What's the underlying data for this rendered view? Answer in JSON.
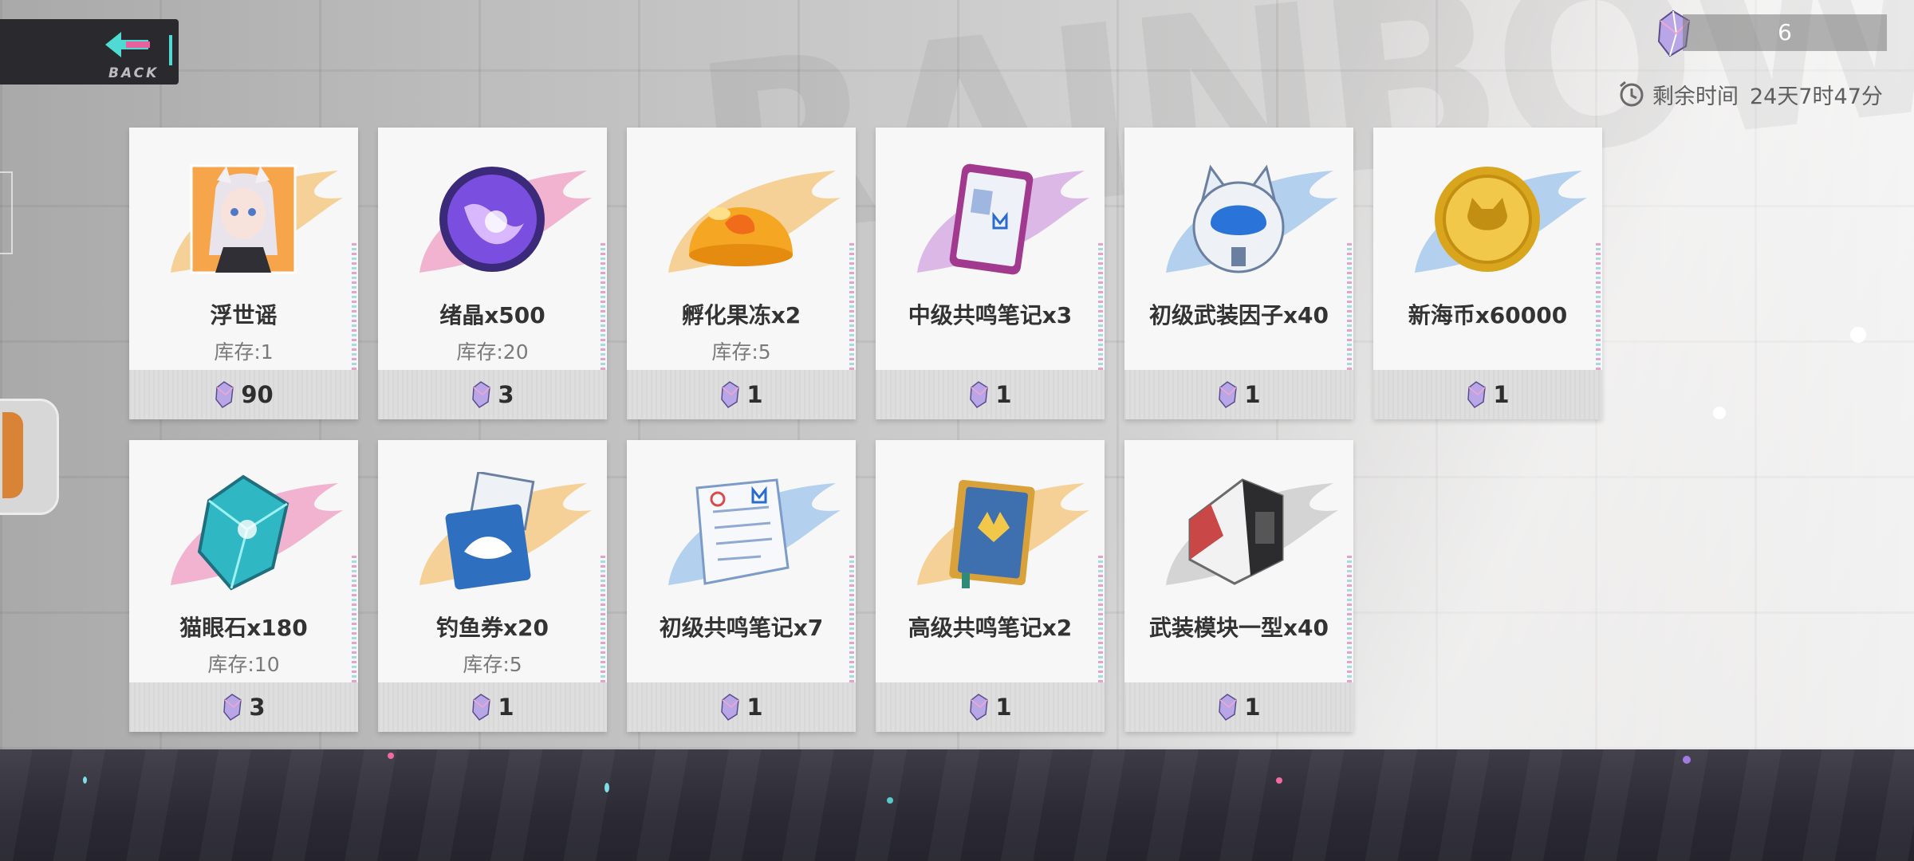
{
  "header": {
    "back_label": "BACK"
  },
  "currency": {
    "icon": "crystal-icon",
    "value": "6"
  },
  "timer": {
    "icon": "clock-icon",
    "label": "剩余时间",
    "value": "24天7时47分"
  },
  "items": [
    {
      "name": "浮世谣",
      "stock": "库存:1",
      "price": "90",
      "icon": "character-portrait-icon",
      "accent": "#f4b24a"
    },
    {
      "name": "绪晶x500",
      "stock": "库存:20",
      "price": "3",
      "icon": "purple-orb-icon",
      "accent": "#ec6fa7"
    },
    {
      "name": "孵化果冻x2",
      "stock": "库存:5",
      "price": "1",
      "icon": "orange-jelly-icon",
      "accent": "#f4b24a"
    },
    {
      "name": "中级共鸣笔记x3",
      "stock": "",
      "price": "1",
      "icon": "tablet-notes-icon",
      "accent": "#c27ad8"
    },
    {
      "name": "初级武装因子x40",
      "stock": "",
      "price": "1",
      "icon": "cat-helmet-icon",
      "accent": "#6fa9e6"
    },
    {
      "name": "新海币x60000",
      "stock": "",
      "price": "1",
      "icon": "gold-coin-icon",
      "accent": "#6fa9e6"
    },
    {
      "name": "猫眼石x180",
      "stock": "库存:10",
      "price": "3",
      "icon": "cyan-gem-icon",
      "accent": "#ec6fa7"
    },
    {
      "name": "钓鱼券x20",
      "stock": "库存:5",
      "price": "1",
      "icon": "fishing-ticket-icon",
      "accent": "#f4b24a"
    },
    {
      "name": "初级共鸣笔记x7",
      "stock": "",
      "price": "1",
      "icon": "paper-notes-icon",
      "accent": "#6fa9e6"
    },
    {
      "name": "高级共鸣笔记x2",
      "stock": "",
      "price": "1",
      "icon": "gold-book-icon",
      "accent": "#f4b24a"
    },
    {
      "name": "武装模块一型x40",
      "stock": "",
      "price": "1",
      "icon": "armor-module-icon",
      "accent": "#bdbdbd"
    }
  ]
}
